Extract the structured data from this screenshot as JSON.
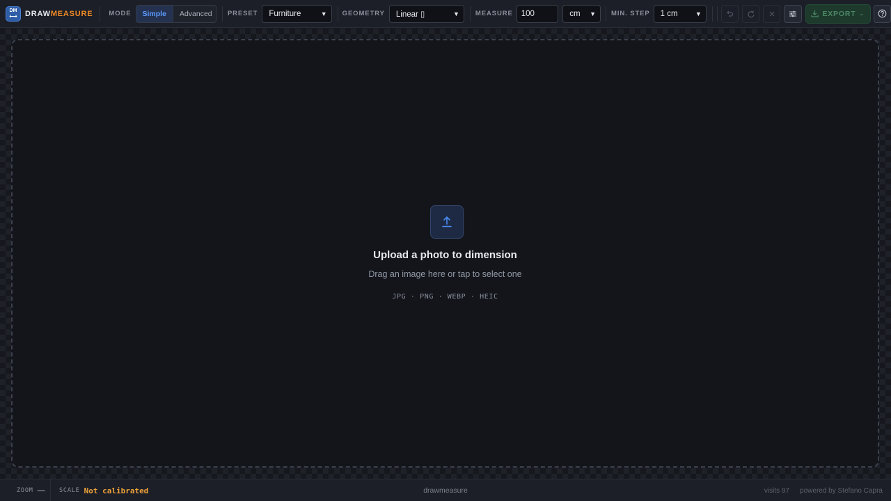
{
  "app": {
    "logo_badge": "DM",
    "logo_badge_arrows": "⟷",
    "name_part1": "DRAW",
    "name_part2": "MEASURE"
  },
  "toolbar": {
    "mode_label": "MODE",
    "mode_options": [
      "Simple",
      "Advanced"
    ],
    "mode_selected": "Simple",
    "preset_label": "PRESET",
    "preset_value": "Furniture",
    "geometry_label": "GEOMETRY",
    "geometry_value": "Linear ▯",
    "measure_label": "MEASURE",
    "measure_value": "100",
    "unit_value": "cm",
    "minstep_label": "MIN. STEP",
    "minstep_value": "1 cm",
    "undo_icon": "undo-icon",
    "redo_icon": "redo-icon",
    "clear_icon": "close-icon",
    "settings_icon": "sliders-icon",
    "export_label": "EXPORT",
    "help_icon": "question-icon"
  },
  "dropzone": {
    "title": "Upload a photo to dimension",
    "subtitle": "Drag an image here or tap to select one",
    "formats": "JPG · PNG · WEBP · HEIC"
  },
  "statusbar": {
    "zoom_label": "ZOOM",
    "zoom_value": "—",
    "scale_label": "SCALE",
    "scale_value": "Not calibrated",
    "center_text": "drawmeasure",
    "visits": "visits 97",
    "credit": "powered by Stefano Capra"
  },
  "colors": {
    "accent": "#5e9cff",
    "brand_orange": "#f08a24",
    "warning": "#f0a33a",
    "export_green": "#1d3a2c"
  }
}
